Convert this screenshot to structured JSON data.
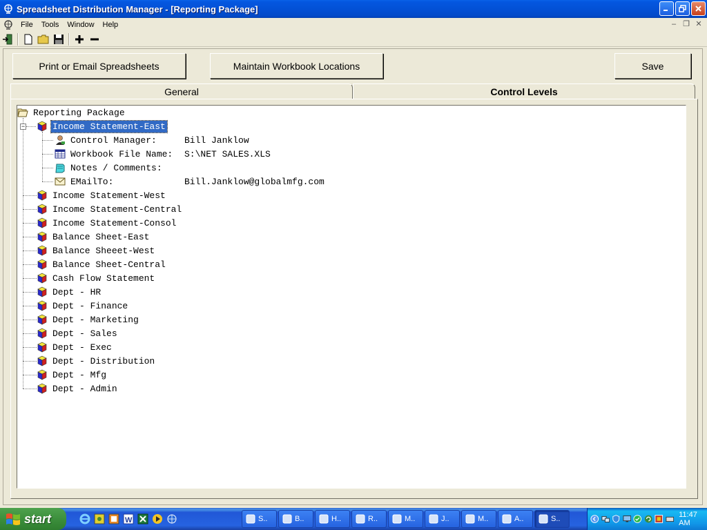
{
  "window": {
    "title": "Spreadsheet Distribution Manager - [Reporting Package]"
  },
  "menu": {
    "items": [
      "File",
      "Tools",
      "Window",
      "Help"
    ]
  },
  "toolbar": {
    "icons": [
      "exit-icon",
      "new-document-icon",
      "open-folder-icon",
      "save-disk-icon",
      "add-icon",
      "remove-icon"
    ]
  },
  "actions": {
    "print_email_label": "Print or Email Spreadsheets",
    "maintain_label": "Maintain Workbook Locations",
    "save_label": "Save"
  },
  "tabs": [
    {
      "label": "General",
      "active": false
    },
    {
      "label": "Control Levels",
      "active": true
    }
  ],
  "tree": {
    "root": "Reporting Package",
    "selected": "Income Statement-East",
    "details": [
      {
        "label": "Control Manager:",
        "value": "Bill Janklow",
        "icon": "person-icon"
      },
      {
        "label": "Workbook File Name:",
        "value": "S:\\NET SALES.XLS",
        "icon": "spreadsheet-icon"
      },
      {
        "label": "Notes / Comments:",
        "value": "",
        "icon": "notepad-icon"
      },
      {
        "label": "EMailTo:",
        "value": "Bill.Janklow@globalmfg.com",
        "icon": "envelope-icon"
      }
    ],
    "items": [
      "Income Statement-West",
      "Income Statement-Central",
      "Income Statement-Consol",
      "Balance Sheet-East",
      "Balance Sheeet-West",
      "Balance Sheet-Central",
      "Cash Flow Statement",
      "Dept - HR",
      "Dept - Finance",
      "Dept - Marketing",
      "Dept - Sales",
      "Dept - Exec",
      "Dept - Distribution",
      "Dept - Mfg",
      "Dept - Admin"
    ]
  },
  "taskbar": {
    "start_label": "start",
    "tasks": [
      "S..",
      "B..",
      "H..",
      "R..",
      "M..",
      "J..",
      "M..",
      "A..",
      "S.."
    ],
    "clock": "11:47 AM"
  },
  "colors": {
    "selection": "#316ac5",
    "titlebar": "#0351d6",
    "face": "#ece9d8"
  }
}
